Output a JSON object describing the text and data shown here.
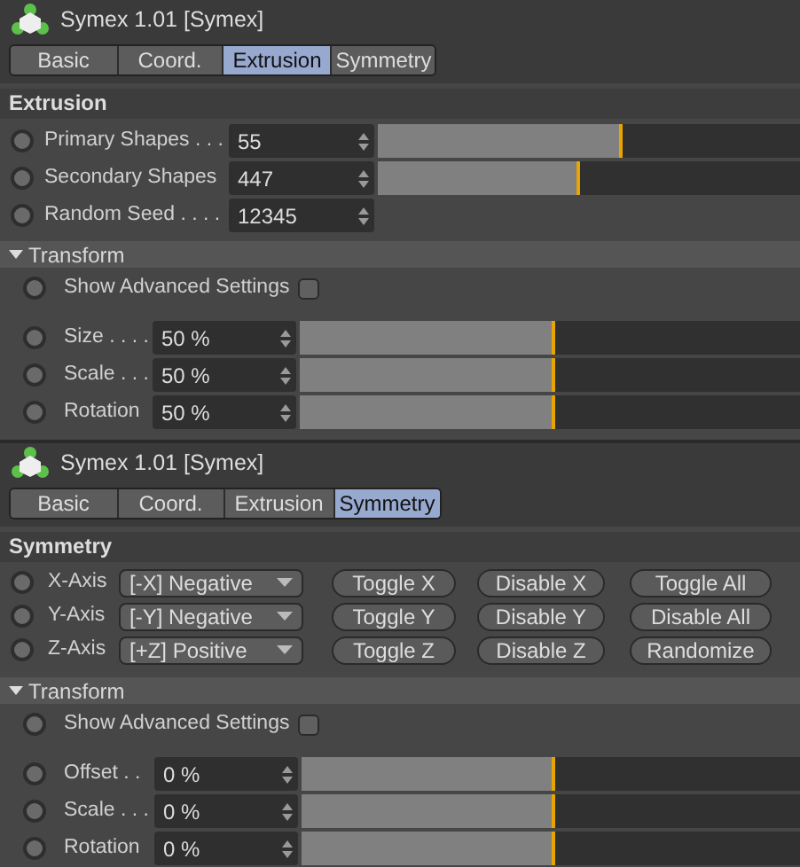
{
  "panels": [
    {
      "title": "Symex 1.01 [Symex]",
      "tabs": [
        {
          "label": "Basic",
          "selected": false
        },
        {
          "label": "Coord.",
          "selected": false
        },
        {
          "label": "Extrusion",
          "selected": true
        },
        {
          "label": "Symmetry",
          "selected": false
        }
      ],
      "section": {
        "title": "Extrusion",
        "rows": [
          {
            "kind": "slider",
            "label": "Primary Shapes . . .",
            "value": "55",
            "level": 0.58,
            "keyframed": false
          },
          {
            "kind": "slider",
            "label": "Secondary Shapes",
            "value": "447",
            "level": 0.48,
            "keyframed": false
          },
          {
            "kind": "number",
            "label": "Random Seed . . . .",
            "value": "12345",
            "keyframed": false
          }
        ]
      },
      "transform": {
        "title": "Transform",
        "expanded": true,
        "advanced": {
          "label": "Show Advanced Settings",
          "checked": false,
          "keyframed": false
        },
        "rows": [
          {
            "label": "Size . . . .",
            "value": "50 %",
            "level": 0.51,
            "keyframed": false
          },
          {
            "label": "Scale . . .",
            "value": "50 %",
            "level": 0.51,
            "keyframed": false
          },
          {
            "label": "Rotation",
            "value": "50 %",
            "level": 0.51,
            "keyframed": false
          }
        ]
      }
    },
    {
      "title": "Symex 1.01 [Symex]",
      "tabs": [
        {
          "label": "Basic",
          "selected": false
        },
        {
          "label": "Coord.",
          "selected": false
        },
        {
          "label": "Extrusion",
          "selected": false
        },
        {
          "label": "Symmetry",
          "selected": true
        }
      ],
      "section": {
        "title": "Symmetry",
        "rows": [
          {
            "kind": "axis",
            "label": "X-Axis",
            "value": "[-X] Negative",
            "buttons": [
              "Toggle X",
              "Disable X",
              "Toggle All"
            ],
            "keyframed": false
          },
          {
            "kind": "axis",
            "label": "Y-Axis",
            "value": "[-Y] Negative",
            "buttons": [
              "Toggle Y",
              "Disable Y",
              "Disable All"
            ],
            "keyframed": false
          },
          {
            "kind": "axis",
            "label": "Z-Axis",
            "value": "[+Z] Positive",
            "buttons": [
              "Toggle Z",
              "Disable Z",
              "Randomize"
            ],
            "keyframed": false
          }
        ]
      },
      "transform": {
        "title": "Transform",
        "expanded": true,
        "advanced": {
          "label": "Show Advanced Settings",
          "checked": false,
          "keyframed": false
        },
        "rows": [
          {
            "label": "Offset . .",
            "value": "0 %",
            "level": 0.51,
            "keyframed": false
          },
          {
            "label": "Scale . . .",
            "value": "0 %",
            "level": 0.51,
            "keyframed": false
          },
          {
            "label": "Rotation",
            "value": "0 %",
            "level": 0.51,
            "keyframed": false
          }
        ]
      }
    }
  ]
}
